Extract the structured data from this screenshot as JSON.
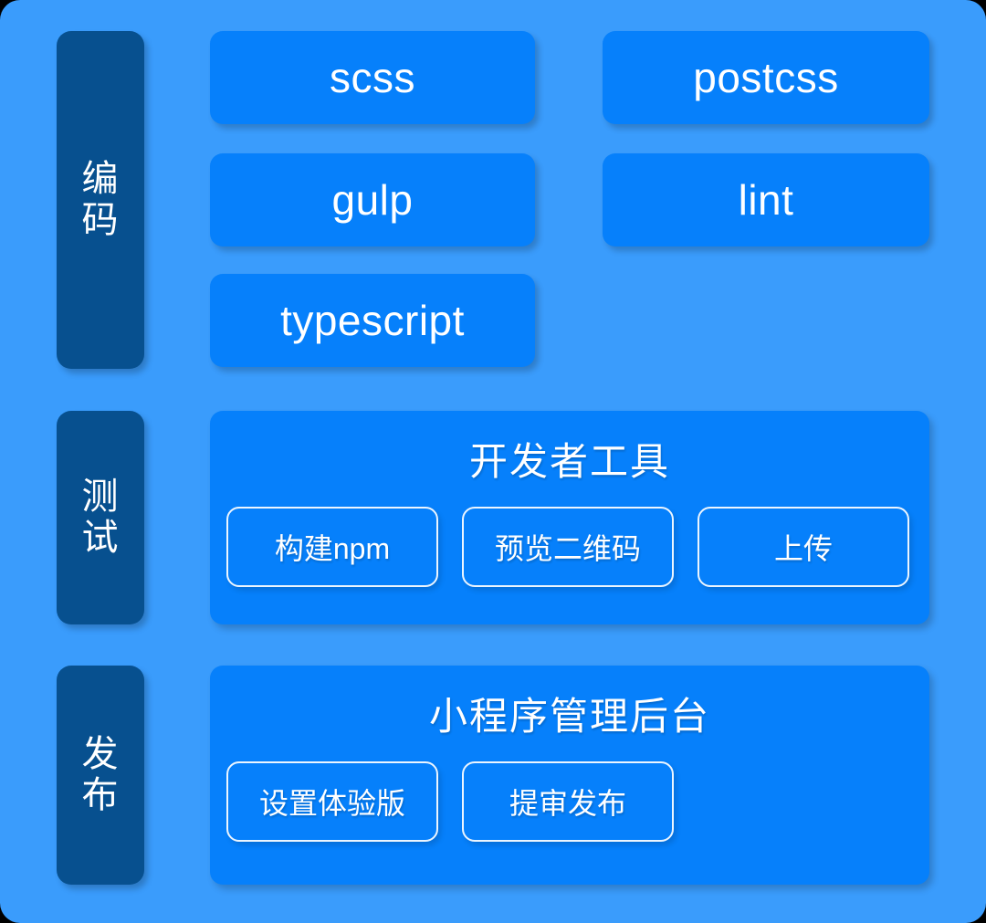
{
  "colors": {
    "background": "#3a9cfc",
    "card": "#0680fb",
    "stage_label": "#07508f",
    "text": "#ffffff",
    "pill_border": "#ffffff"
  },
  "stages": [
    {
      "label": "编码",
      "tools": [
        {
          "name": "scss"
        },
        {
          "name": "postcss"
        },
        {
          "name": "gulp"
        },
        {
          "name": "lint"
        },
        {
          "name": "typescript"
        }
      ]
    },
    {
      "label": "测试",
      "panel": {
        "title": "开发者工具",
        "actions": [
          {
            "name": "构建npm"
          },
          {
            "name": "预览二维码"
          },
          {
            "name": "上传"
          }
        ]
      }
    },
    {
      "label": "发布",
      "panel": {
        "title": "小程序管理后台",
        "actions": [
          {
            "name": "设置体验版"
          },
          {
            "name": "提审发布"
          }
        ]
      }
    }
  ]
}
